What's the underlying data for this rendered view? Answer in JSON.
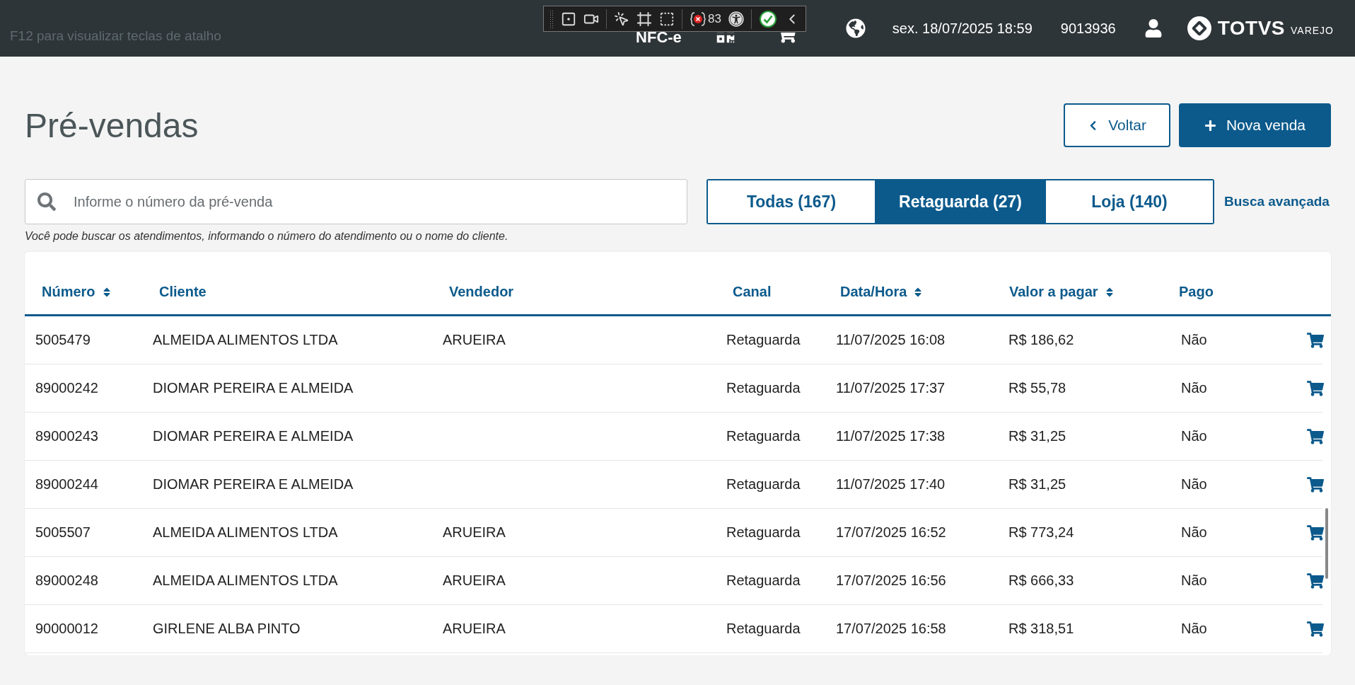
{
  "top_bar": {
    "shortcut_hint": "F12 para visualizar teclas de atalho",
    "module": "NFC-e",
    "datetime": "sex. 18/07/2025 18:59",
    "terminal": "9013936",
    "brand": "TOTVS",
    "brand_sub": "VAREJO"
  },
  "dev_toolbar": {
    "error_count": "83"
  },
  "page": {
    "title": "Pré-vendas",
    "buttons": [
      {
        "label": "Voltar",
        "kind": "back"
      },
      {
        "label": "Nova venda",
        "kind": "primary"
      }
    ]
  },
  "search": {
    "placeholder": "Informe o número da pré-venda",
    "hint": "Você pode buscar os atendimentos, informando o número do atendimento ou o nome do cliente."
  },
  "filter_tabs": [
    {
      "label": "Todas (167)",
      "selected": false
    },
    {
      "label": "Retaguarda (27)",
      "selected": true
    },
    {
      "label": "Loja (140)",
      "selected": false
    }
  ],
  "advanced_search": "Busca avançada",
  "table": {
    "columns": [
      {
        "label": "Número",
        "sortable": true
      },
      {
        "label": "Cliente",
        "sortable": false
      },
      {
        "label": "Vendedor",
        "sortable": false
      },
      {
        "label": "Canal",
        "sortable": false
      },
      {
        "label": "Data/Hora",
        "sortable": true
      },
      {
        "label": "Valor a pagar",
        "sortable": true
      },
      {
        "label": "Pago",
        "sortable": false
      }
    ],
    "rows": [
      {
        "cells": [
          "5005479",
          "ALMEIDA ALIMENTOS LTDA",
          "ARUEIRA",
          "Retaguarda",
          "11/07/2025 16:08",
          "R$ 186,62",
          "Não"
        ]
      },
      {
        "cells": [
          "89000242",
          "DIOMAR PEREIRA E ALMEIDA",
          "",
          "Retaguarda",
          "11/07/2025 17:37",
          "R$ 55,78",
          "Não"
        ]
      },
      {
        "cells": [
          "89000243",
          "DIOMAR PEREIRA E ALMEIDA",
          "",
          "Retaguarda",
          "11/07/2025 17:38",
          "R$ 31,25",
          "Não"
        ]
      },
      {
        "cells": [
          "89000244",
          "DIOMAR PEREIRA E ALMEIDA",
          "",
          "Retaguarda",
          "11/07/2025 17:40",
          "R$ 31,25",
          "Não"
        ]
      },
      {
        "cells": [
          "5005507",
          "ALMEIDA ALIMENTOS LTDA",
          "ARUEIRA",
          "Retaguarda",
          "17/07/2025 16:52",
          "R$ 773,24",
          "Não"
        ]
      },
      {
        "cells": [
          "89000248",
          "ALMEIDA ALIMENTOS LTDA",
          "ARUEIRA",
          "Retaguarda",
          "17/07/2025 16:56",
          "R$ 666,33",
          "Não"
        ]
      },
      {
        "cells": [
          "90000012",
          "GIRLENE ALBA PINTO",
          "ARUEIRA",
          "Retaguarda",
          "17/07/2025 16:58",
          "R$ 318,51",
          "Não"
        ]
      }
    ]
  }
}
